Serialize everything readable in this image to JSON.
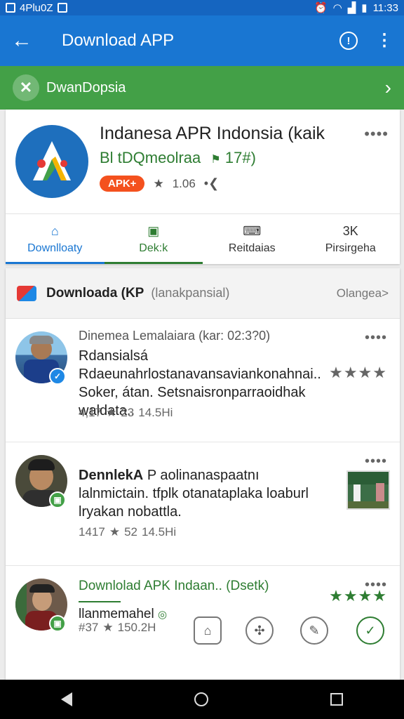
{
  "status": {
    "left_text": "4Plu0Z",
    "time": "11:33"
  },
  "appbar": {
    "title": "Download APP",
    "back_icon": "arrow-left-icon",
    "info_icon": "info-icon",
    "menu_icon": "more-vert-icon"
  },
  "banner": {
    "label": "DwanDopsia",
    "icon": "close-x-icon",
    "chevron_icon": "chevron-right-icon"
  },
  "app": {
    "title": "Indanesa APR Indonsia (kaik",
    "developer": "Bl tDQmeolraa",
    "flag_text": "17#)",
    "badge": "APK+",
    "rating": "1.06",
    "more": "••••"
  },
  "tabs": [
    {
      "icon": "home-icon",
      "label": "Downlloaty"
    },
    {
      "icon": "image-icon",
      "label": "Dek:k"
    },
    {
      "icon": "keyboard-icon",
      "label": "Reitdaias"
    },
    {
      "icon": "",
      "top": "3K",
      "label": "Pirsirgeha"
    }
  ],
  "list": {
    "header_title": "Downloada (KP",
    "header_sub": "(lanakpansial)",
    "header_action": "Olangea>",
    "posts": [
      {
        "head": "Dinemea Lemalaiara (kar: 02:3?0)",
        "body": "Rdansialsá Rdaeunahrlostanavansaviankonahnai.. Soker, átan. Setsnaisronparraoidhak waldata..",
        "stats": [
          "4,17",
          "23",
          "14.5Hi"
        ],
        "stars": "★★★★"
      },
      {
        "body_bold": "DennlekA",
        "body": "P aolinanaspaatnı lalnmictain. tfplk otanataplaka loaburl lryakan nobattla.",
        "stats": [
          "1417",
          "52",
          "14.5Hi"
        ]
      },
      {
        "title": "Downlolad APK Indaan.. (Dsetk)",
        "sub": "llanmemahel",
        "stats": [
          "#37",
          "150.2H"
        ],
        "stars": "★★★★"
      }
    ]
  },
  "colors": {
    "primary": "#1976d2",
    "green": "#43a047",
    "accent": "#f4511e"
  }
}
